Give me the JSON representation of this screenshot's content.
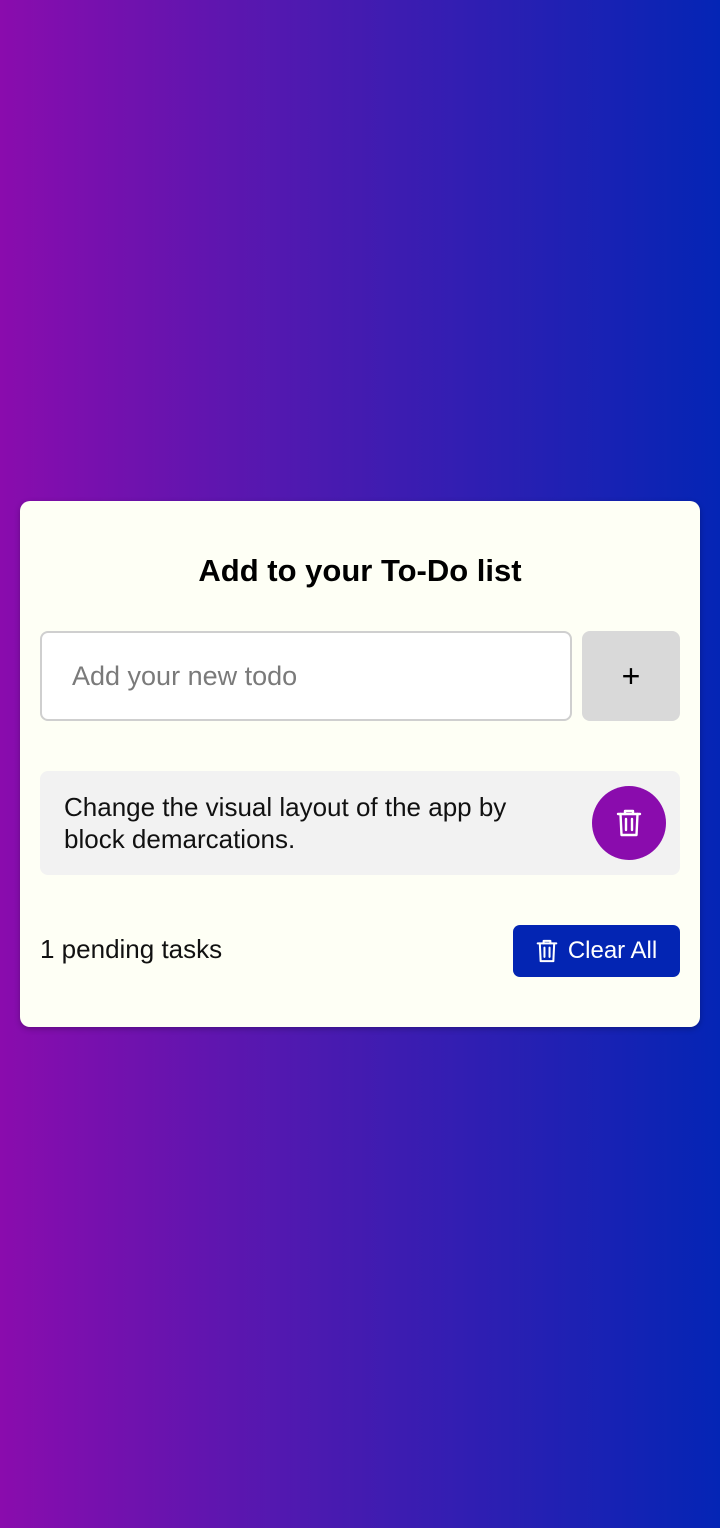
{
  "app": {
    "title": "Add to your To-Do list"
  },
  "input": {
    "placeholder": "Add your new todo",
    "value": ""
  },
  "add_button": {
    "label": "+"
  },
  "todos": [
    {
      "text": "Change the visual layout of the app by block demarcations.",
      "delete_icon": "trash-icon"
    }
  ],
  "footer": {
    "pending_text": "1 pending tasks",
    "clear_label": "Clear All",
    "clear_icon": "trash-icon"
  },
  "colors": {
    "gradient_start": "#8a0cad",
    "gradient_end": "#0425b5",
    "card_background": "#fefff5",
    "delete_button": "#8a0cad",
    "clear_button": "#0325b3",
    "add_button": "#d9d9d9"
  }
}
